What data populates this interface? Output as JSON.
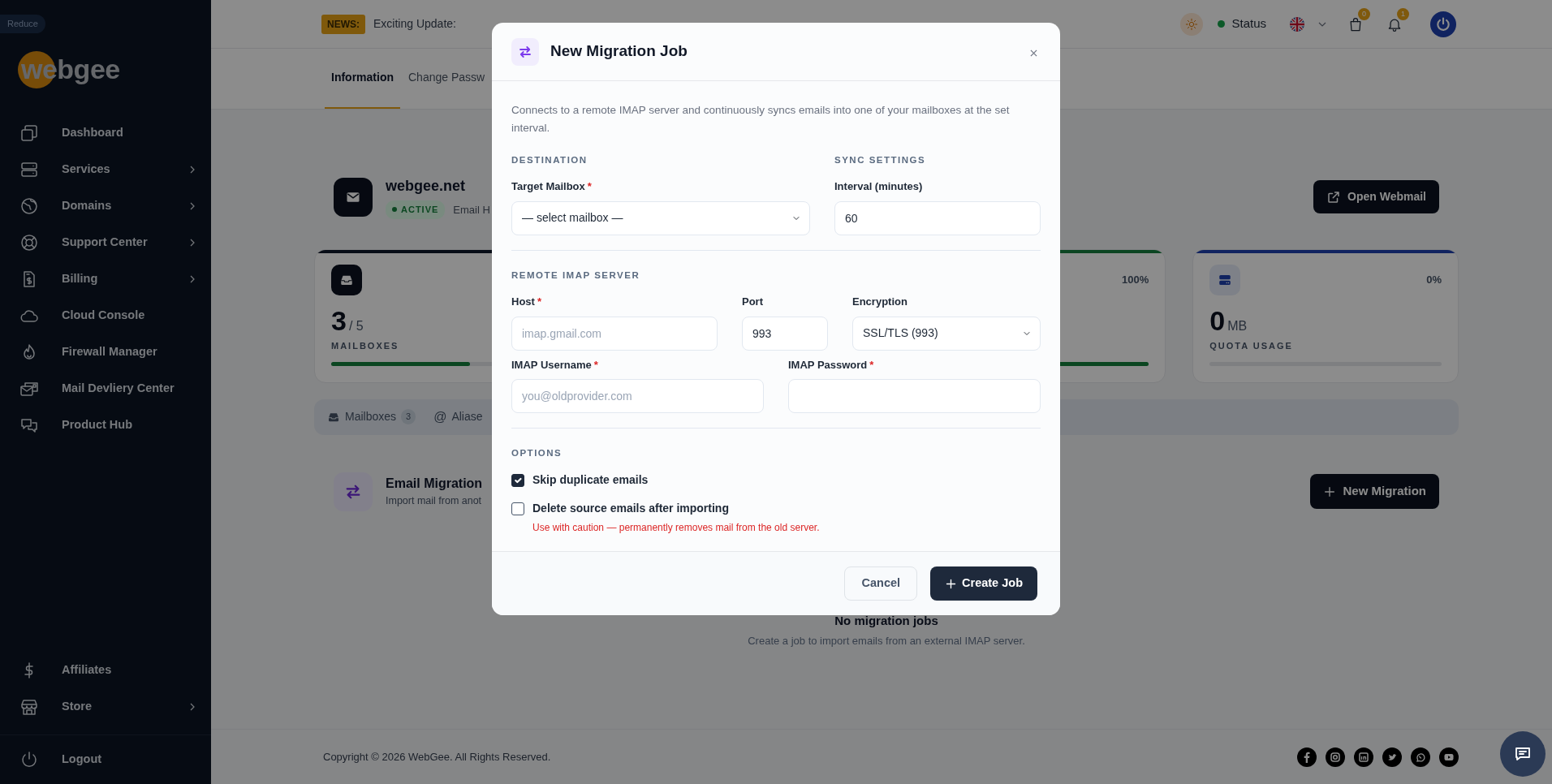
{
  "sidebar": {
    "reduce_label": "Reduce",
    "logo": "webgee",
    "items": [
      {
        "label": "Dashboard",
        "has_submenu": false
      },
      {
        "label": "Services",
        "has_submenu": true
      },
      {
        "label": "Domains",
        "has_submenu": true
      },
      {
        "label": "Support Center",
        "has_submenu": true
      },
      {
        "label": "Billing",
        "has_submenu": true
      },
      {
        "label": "Cloud Console",
        "has_submenu": false
      },
      {
        "label": "Firewall Manager",
        "has_submenu": false
      },
      {
        "label": "Mail Devliery Center",
        "has_submenu": false
      },
      {
        "label": "Product Hub",
        "has_submenu": false
      }
    ],
    "bottom_items": [
      {
        "label": "Affiliates",
        "has_submenu": false
      },
      {
        "label": "Store",
        "has_submenu": true
      }
    ],
    "logout": "Logout"
  },
  "header": {
    "news_badge": "NEWS:",
    "news_text": "Exciting Update:",
    "status": "Status",
    "cart_count": "0",
    "notification_count": "1"
  },
  "page_tabs": [
    {
      "label": "Information",
      "selected": true
    },
    {
      "label": "Change Passw",
      "selected": false
    }
  ],
  "domain": {
    "name": "webgee.net",
    "status": "ACTIVE",
    "subtitle": "Email H",
    "button": "Open Webmail"
  },
  "stats": [
    {
      "value": "3",
      "unit": "/ 5",
      "label": "MAILBOXES",
      "level": 0.6,
      "color": "#080d17"
    },
    {
      "percent": "100%",
      "level": 1,
      "color": "#0c4622"
    },
    {
      "percent": "0%",
      "value": "0",
      "unit": "MB",
      "label": "QUOTA USAGE",
      "level": 0,
      "color": "#112360"
    }
  ],
  "section_tabs": [
    {
      "label": "Mailboxes",
      "count": "3"
    },
    {
      "symbol": "@",
      "label": "Aliase"
    }
  ],
  "migration": {
    "title": "Email Migration",
    "subtitle": "Import mail from anot",
    "button": "New Migration",
    "empty_title": "No migration jobs",
    "empty_text": "Create a job to import emails from an external IMAP server."
  },
  "footer": {
    "copyright": "Copyright © 2026 WebGee. All Rights Reserved."
  },
  "modal": {
    "title": "New Migration Job",
    "description": "Connects to a remote IMAP server and continuously syncs emails into one of your mailboxes at the set interval.",
    "destination_heading": "DESTINATION",
    "sync_heading": "SYNC SETTINGS",
    "target_mailbox": {
      "label": "Target Mailbox",
      "required_mark": "*",
      "kind": "select",
      "value": "— select mailbox —"
    },
    "interval": {
      "label": "Interval (minutes)",
      "kind": "input",
      "value": "60"
    },
    "remote_heading": "REMOTE IMAP SERVER",
    "host": {
      "label": "Host",
      "required_mark": "*",
      "kind": "input",
      "placeholder": "imap.gmail.com"
    },
    "port": {
      "label": "Port",
      "kind": "input",
      "value": "993"
    },
    "encryption": {
      "label": "Encryption",
      "kind": "select",
      "value": "SSL/TLS (993)"
    },
    "username": {
      "label": "IMAP Username",
      "required_mark": "*",
      "kind": "input",
      "placeholder": "you@oldprovider.com"
    },
    "password": {
      "label": "IMAP Password",
      "required_mark": "*",
      "kind": "password"
    },
    "options_heading": "OPTIONS",
    "options": [
      {
        "label": "Skip duplicate emails",
        "checked": true
      },
      {
        "label": "Delete source emails after importing",
        "checked": false,
        "warning": "Use with caution — permanently removes mail from the old server."
      }
    ],
    "cancel": "Cancel",
    "submit": "Create Job"
  }
}
